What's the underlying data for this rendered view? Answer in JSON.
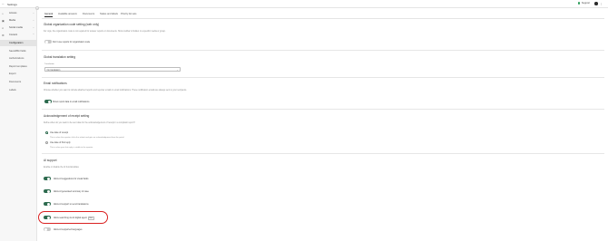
{
  "topbar": {
    "back_icon": "arrow-left-icon",
    "title": "Settings",
    "support_label": "Support",
    "menu_icon": "kebab-icon"
  },
  "sidebar": {
    "items": [
      {
        "label": "Access",
        "icon": "house-icon"
      },
      {
        "label": "Media",
        "icon": "image-icon"
      },
      {
        "label": "Social media",
        "icon": "share-icon"
      },
      {
        "label": "Content",
        "icon": "gear-icon"
      }
    ],
    "subitems": [
      {
        "label": "Configuration",
        "active": true
      },
      {
        "label": "Saved/Bin fields",
        "active": false
      },
      {
        "label": "Authorizations",
        "active": false
      },
      {
        "label": "Report templates",
        "active": false
      },
      {
        "label": "Export",
        "active": false
      },
      {
        "label": "Documents",
        "active": false
      },
      {
        "label": "Labels",
        "active": false
      }
    ]
  },
  "tabs": [
    "General",
    "Available answers",
    "Documents",
    "Status and labels",
    "Priority list sets"
  ],
  "sections": {
    "org_code": {
      "title": "Global organization code setting (web only)",
      "desc": "For orgs, the organization code is not required for answer reports or documents. Show toolbar is hidden in a specific media or group.",
      "toggle_label": "Don't use reports for organization code"
    },
    "translation": {
      "title": "Global translation setting",
      "field_label": "Translation",
      "select_value": "No translation"
    },
    "email": {
      "title": "Email notifications",
      "desc": "Choose whether you want to include attached reports and reporter emails in email notifications. These notification emails are always sent to your recipients.",
      "toggle_label": "Show report data in email notifications"
    },
    "ack": {
      "title": "Acknowledgement of receipt setting",
      "desc": "Define when do you want to be sent date for the acknowledgement of receipt in a complaint report?",
      "options": [
        {
          "label": "Use date of receipt",
          "desc": "This is when the reporter clicks the submit and gets an acknowledgement from the portal.",
          "checked": true
        },
        {
          "label": "Use date of first reply",
          "desc": "This is when your first reply is visible to the reporter.",
          "checked": false
        }
      ]
    },
    "ai": {
      "title": "AI support",
      "desc": "Enable or disable the AI functionalities",
      "toggles": [
        {
          "label": "Allow AI suggestions for visual fields",
          "on": true,
          "badge": ""
        },
        {
          "label": "Allow AI generated summary of case",
          "on": true,
          "badge": ""
        },
        {
          "label": "Allow AI support to send translations",
          "on": true,
          "badge": ""
        },
        {
          "label": "Allow searching via AI digital agent",
          "on": true,
          "badge": "Beta"
        },
        {
          "label": "Allow AI supported languages",
          "on": false,
          "badge": ""
        }
      ]
    }
  },
  "colors": {
    "toggle_on": "#2e6b4f",
    "highlight": "#d92020",
    "support_dot": "#2e9e5b"
  }
}
